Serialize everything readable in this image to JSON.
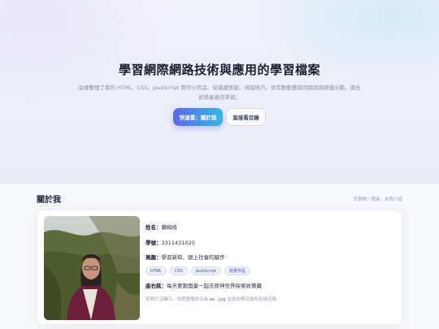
{
  "hero": {
    "title": "學習網際網路技術與應用的學習檔案",
    "description": "這裡整理了我的 HTML、CSS、JavaScript 實作小作品、從基礎排版、排版技巧，到互動動畫與同網頁與綁盛示範，適合初學者循序學習。",
    "primary_button": "快速看：關於我",
    "secondary_button": "直接看目錄"
  },
  "about": {
    "section_title": "關於我",
    "section_hint": "背景簡一語風．自我介紹",
    "name_label": "姓名：",
    "name_value": "賴梅枝",
    "student_id_label": "學號：",
    "student_id_value": "3311431020",
    "hobby_label": "美趣：",
    "hobby_value": "學習新知、跟上社會的腳步",
    "tags": [
      "HTML",
      "CSS",
      "JavaScript",
      "前書作品"
    ],
    "motto_label": "座右銘：",
    "motto_value": "每天要跟面量一起去原神世界探索收寶藏",
    "note_prefix": "若照片沒顯示，請把圖檔命名為 ",
    "note_code": "me.jpg",
    "note_suffix": " 並放到根目錄和本頁同層。"
  },
  "colors": {
    "accent_start": "#5b68e8",
    "accent_end": "#38b6e3"
  }
}
